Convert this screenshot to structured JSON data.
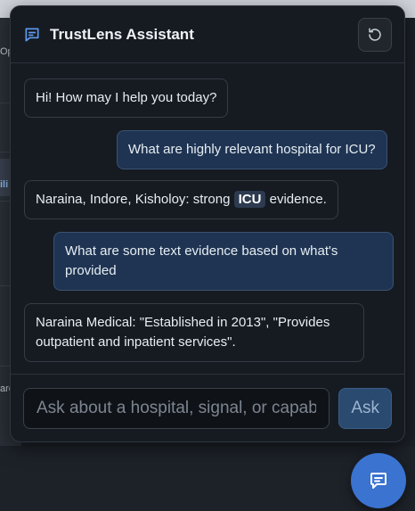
{
  "background": {
    "fragments": [
      "Op",
      "ili",
      "are"
    ]
  },
  "header": {
    "title": "TrustLens Assistant"
  },
  "messages": [
    {
      "role": "bot",
      "text": "Hi! How may I help you today?"
    },
    {
      "role": "user",
      "text": "What are highly relevant hospital for ICU?"
    },
    {
      "role": "bot",
      "text_before": "Naraina, Indore, Kisholoy: strong ",
      "tag": "ICU",
      "text_after": " evidence."
    },
    {
      "role": "user",
      "text": "What are some text evidence based on what's provided"
    },
    {
      "role": "bot",
      "text": "Naraina Medical: \"Established in 2013\", \"Provides outpatient and inpatient services\"."
    }
  ],
  "composer": {
    "placeholder": "Ask about a hospital, signal, or capabil",
    "value": "",
    "ask_label": "Ask"
  },
  "colors": {
    "accent": "#3a73d0",
    "panel_bg": "#161b22",
    "user_bubble": "#1f3452"
  }
}
